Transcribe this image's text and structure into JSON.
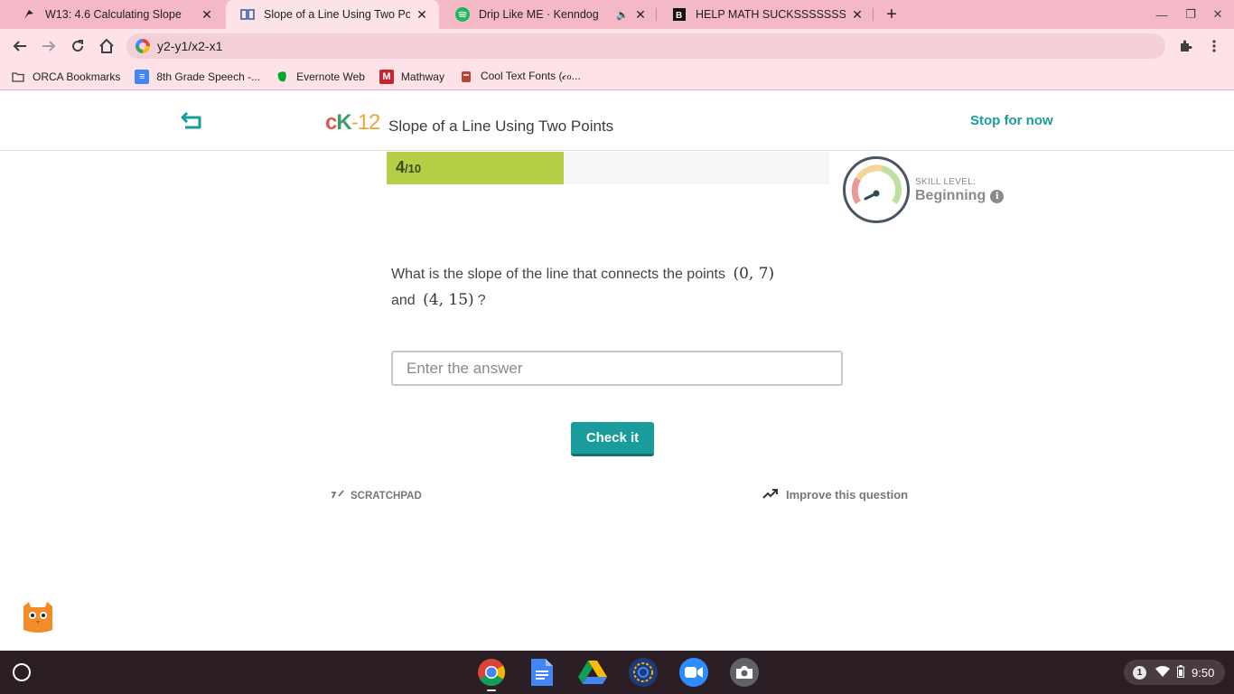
{
  "browser": {
    "tabs": [
      {
        "title": "W13: 4.6 Calculating Slope",
        "icon": "canvas-icon",
        "active": false
      },
      {
        "title": "Slope of a Line Using Two Points",
        "icon": "book-icon",
        "active": true
      },
      {
        "title": "Drip Like ME · Kenndog",
        "icon": "spotify-icon",
        "active": false,
        "playing_audio": true
      },
      {
        "title": "HELP MATH SUCKSSSSSSSSSSS",
        "icon": "brainly-icon",
        "active": false
      }
    ],
    "address_bar": {
      "value": "y2-y1/x2-x1"
    },
    "bookmarks": [
      {
        "label": "ORCA Bookmarks",
        "icon": "folder-icon"
      },
      {
        "label": "8th Grade Speech -...",
        "icon": "docs-icon"
      },
      {
        "label": "Evernote Web",
        "icon": "evernote-icon"
      },
      {
        "label": "Mathway",
        "icon": "mathway-icon"
      },
      {
        "label": "Cool Text Fonts (𝒸ℴ...",
        "icon": "fonts-icon"
      }
    ]
  },
  "app": {
    "logo": {
      "c": "c",
      "k": "K",
      "num": "-12"
    },
    "lesson_title": "Slope of a Line Using Two Points",
    "stop_label": "Stop for now",
    "accent_color": "#1a9c9c"
  },
  "progress": {
    "current": "4",
    "total": "/10",
    "fraction": 0.4
  },
  "skill": {
    "label": "SKILL LEVEL:",
    "value": "Beginning"
  },
  "question": {
    "text_before": "What is the slope of the line that connects the points",
    "point1": "(0, 7)",
    "conjunction": "and",
    "point2": "(4, 15)",
    "end": "?"
  },
  "answer": {
    "placeholder": "Enter the answer",
    "value": ""
  },
  "check_button": {
    "label": "Check it"
  },
  "tools": {
    "scratchpad": "SCRATCHPAD",
    "improve": "Improve this question"
  },
  "system": {
    "time": "9:50",
    "notification_count": "1"
  }
}
